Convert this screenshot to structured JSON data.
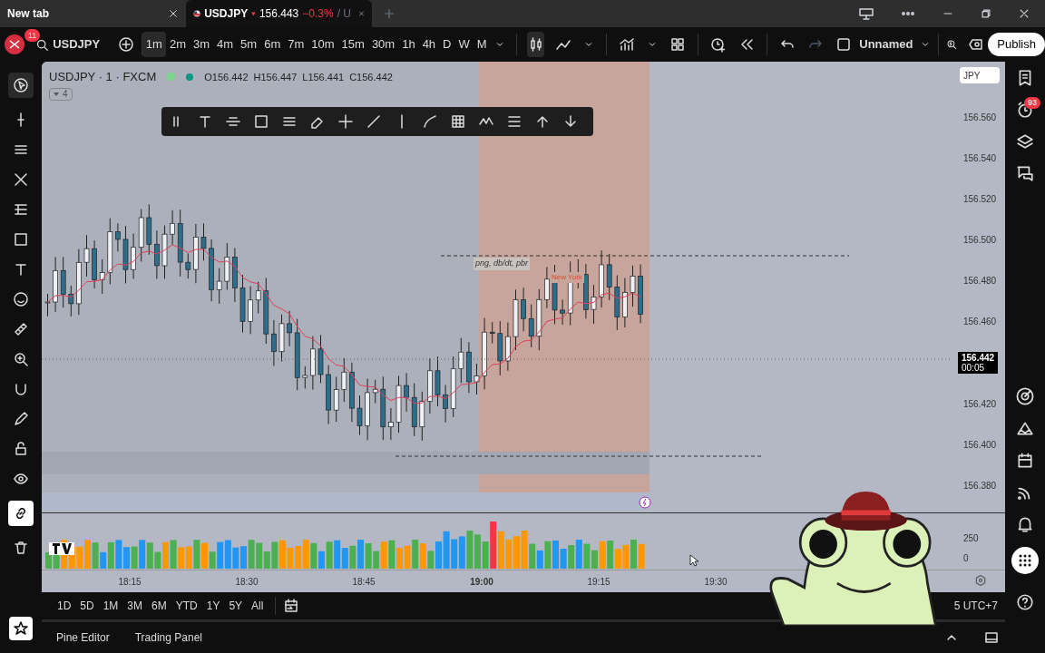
{
  "browser_tabs": [
    {
      "label": "New tab",
      "selected": false
    },
    {
      "label": "USDJPY",
      "price": "156.443",
      "change": "−0.3%",
      "suffix": "/ U",
      "selected": true
    }
  ],
  "header": {
    "notification_count": "11",
    "symbol": "USDJPY",
    "intervals": [
      {
        "label": "1m",
        "selected": true
      },
      {
        "label": "2m",
        "selected": false
      },
      {
        "label": "3m",
        "selected": false
      },
      {
        "label": "4m",
        "selected": false
      },
      {
        "label": "5m",
        "selected": false
      },
      {
        "label": "6m",
        "selected": false
      },
      {
        "label": "7m",
        "selected": false
      },
      {
        "label": "10m",
        "selected": false
      },
      {
        "label": "15m",
        "selected": false
      },
      {
        "label": "30m",
        "selected": false
      },
      {
        "label": "1h",
        "selected": false
      },
      {
        "label": "4h",
        "selected": false
      },
      {
        "label": "D",
        "selected": false
      },
      {
        "label": "W",
        "selected": false
      },
      {
        "label": "M",
        "selected": false
      }
    ],
    "layout_name": "Unnamed",
    "publish": "Publish"
  },
  "legend": {
    "title": "USDJPY · 1 · FXCM",
    "ohlc": [
      "O156.442",
      "H156.447",
      "L156.441",
      "C156.442"
    ],
    "indicator_count": "4"
  },
  "currency": "JPY",
  "price_ticks": [
    "156.560",
    "156.540",
    "156.520",
    "156.500",
    "156.480",
    "156.460",
    "156.420",
    "156.400",
    "156.380"
  ],
  "current_price": {
    "price": "156.442",
    "countdown": "00:05"
  },
  "annotations": {
    "levels_label": "png, db/dt, pbr",
    "session_label": "New York"
  },
  "volume_ticks": [
    "250",
    "0"
  ],
  "time_ticks": [
    {
      "label": "18:15",
      "major": false
    },
    {
      "label": "18:30",
      "major": false
    },
    {
      "label": "18:45",
      "major": false
    },
    {
      "label": "19:00",
      "major": true
    },
    {
      "label": "19:15",
      "major": false
    },
    {
      "label": "19:30",
      "major": false
    }
  ],
  "ranges": [
    "1D",
    "5D",
    "1M",
    "3M",
    "6M",
    "YTD",
    "1Y",
    "5Y",
    "All"
  ],
  "timezone": "5 UTC+7",
  "bottom_tabs": [
    "Pine Editor",
    "Trading Panel"
  ],
  "right_sidebar": {
    "alerts_badge": "93"
  }
}
